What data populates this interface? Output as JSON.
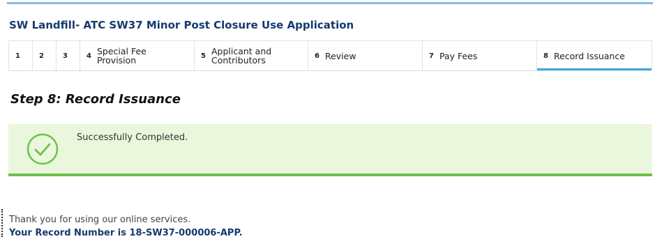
{
  "app": {
    "title": "SW Landfill- ATC SW37 Minor Post Closure Use Application"
  },
  "steps": [
    {
      "num": "1",
      "label": ""
    },
    {
      "num": "2",
      "label": ""
    },
    {
      "num": "3",
      "label": ""
    },
    {
      "num": "4",
      "label": "Special Fee Provision"
    },
    {
      "num": "5",
      "label": "Applicant and Contributors"
    },
    {
      "num": "6",
      "label": "Review"
    },
    {
      "num": "7",
      "label": "Pay Fees"
    },
    {
      "num": "8",
      "label": "Record Issuance",
      "active": true
    }
  ],
  "main": {
    "heading": "Step 8: Record Issuance",
    "success_message": "Successfully Completed.",
    "thanks": "Thank you for using our online services.",
    "record_line": "Your Record Number is 18-SW37-000006-APP."
  },
  "colors": {
    "accent": "#47a7e6",
    "title": "#153b6e",
    "success_bg": "#eaf7dd",
    "success_border": "#6cc24a",
    "check": "#6cc24a"
  },
  "icons": {
    "success": "check-circle-icon"
  }
}
